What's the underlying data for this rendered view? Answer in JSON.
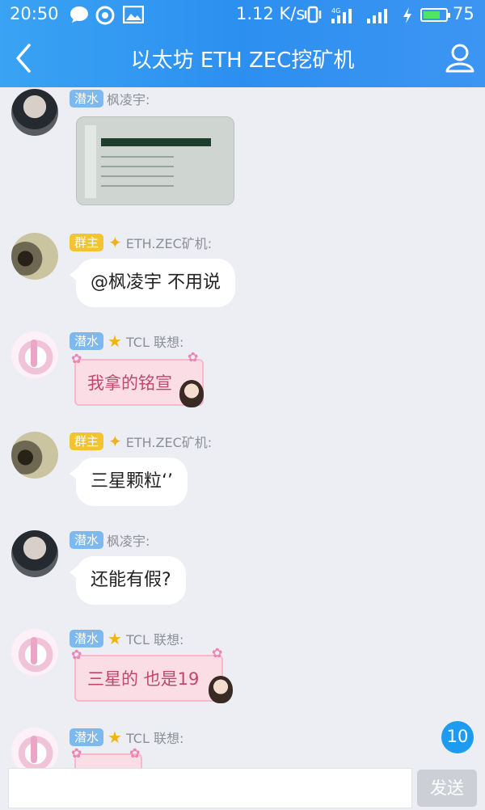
{
  "status_bar": {
    "time": "20:50",
    "speed": "1.12 K/s",
    "battery": "75",
    "battery_level": 0.75,
    "icons": [
      "chat-bubble-icon",
      "camera-icon",
      "gallery-icon",
      "vibrate-icon",
      "signal-4g-icon",
      "signal-bars-icon",
      "charging-icon"
    ]
  },
  "header": {
    "title": "以太坊 ETH ZEC挖矿机",
    "back_icon": "chevron-left-icon",
    "profile_icon": "person-icon"
  },
  "messages": [
    {
      "avatar": "man-avatar",
      "badge": "潜水",
      "sender": "枫凌宇:",
      "type": "image"
    },
    {
      "avatar": "owner-avatar",
      "badge": "群主",
      "sender": "ETH.ZEC矿机:",
      "text": "@枫凌宇 不用说"
    },
    {
      "avatar": "tcl-avatar",
      "badge": "潜水",
      "sender": "TCL 联想:",
      "text": "我拿的铭宣"
    },
    {
      "avatar": "owner-avatar",
      "badge": "群主",
      "sender": "ETH.ZEC矿机:",
      "text": "三星颗粒‘’"
    },
    {
      "avatar": "man-avatar",
      "badge": "潜水",
      "sender": "枫凌宇:",
      "text": "还能有假?"
    },
    {
      "avatar": "tcl-avatar",
      "badge": "潜水",
      "sender": "TCL 联想:",
      "text": "三星的 也是19"
    },
    {
      "avatar": "tcl-avatar",
      "badge": "潜水",
      "sender": "TCL 联想:",
      "text": ""
    }
  ],
  "unread_count": "10",
  "composer": {
    "placeholder": "",
    "send_label": "发送"
  },
  "colors": {
    "header": "#2c8ff0",
    "badge_qianshui": "#7db8ef",
    "badge_qunzhu": "#f2c431",
    "unread": "#1d9bf0",
    "pink_bubble": "#fbdde6"
  }
}
